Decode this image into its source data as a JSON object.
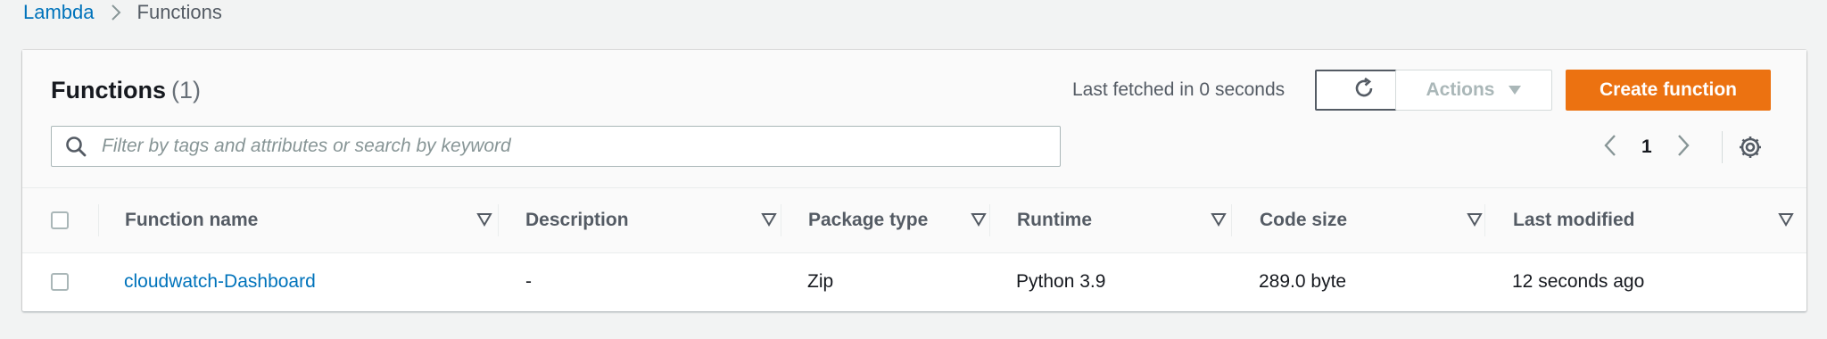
{
  "breadcrumb": {
    "root": "Lambda",
    "current": "Functions"
  },
  "header": {
    "title": "Functions",
    "count": "(1)",
    "last_fetched": "Last fetched in 0 seconds",
    "actions_label": "Actions",
    "create_label": "Create function"
  },
  "search": {
    "placeholder": "Filter by tags and attributes or search by keyword",
    "value": ""
  },
  "pagination": {
    "current_page": "1"
  },
  "table": {
    "columns": [
      "Function name",
      "Description",
      "Package type",
      "Runtime",
      "Code size",
      "Last modified"
    ],
    "rows": [
      {
        "name": "cloudwatch-Dashboard",
        "description": "-",
        "package_type": "Zip",
        "runtime": "Python 3.9",
        "code_size": "289.0 byte",
        "last_modified": "12 seconds ago"
      }
    ]
  },
  "colors": {
    "link": "#0073bb",
    "primary": "#ec7211",
    "text": "#16191f",
    "muted": "#545b64"
  }
}
